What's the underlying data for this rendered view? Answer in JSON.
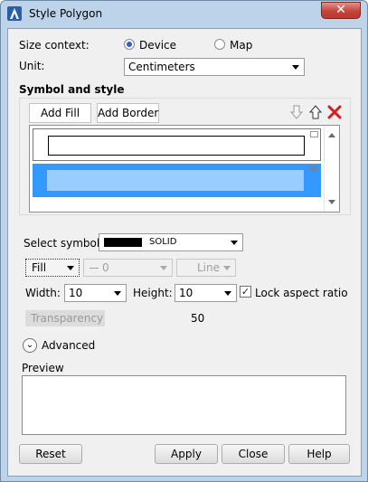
{
  "window": {
    "title": "Style Polygon",
    "close_glyph": "✕"
  },
  "size_context": {
    "label": "Size context:",
    "options": [
      {
        "label": "Device",
        "selected": true
      },
      {
        "label": "Map",
        "selected": false
      }
    ]
  },
  "unit": {
    "label": "Unit:",
    "value": "Centimeters"
  },
  "symbol_and_style": {
    "heading": "Symbol and style",
    "add_fill_label": "Add Fill",
    "add_border_label": "Add Border",
    "icons": [
      "move-down-icon",
      "move-up-icon",
      "delete-icon"
    ]
  },
  "select_symbol": {
    "label": "Select symbol:",
    "value": "SOLID",
    "swatch_color": "#000000"
  },
  "fill_row": {
    "type_value": "Fill",
    "line_value": "0",
    "line_type_value": "Line"
  },
  "dimensions": {
    "width_label": "Width:",
    "width_value": "10",
    "height_label": "Height:",
    "height_value": "10",
    "lock_label": "Lock aspect ratio",
    "lock_checked": true
  },
  "transparency": {
    "label": "Transparency",
    "value": "50"
  },
  "advanced": {
    "label": "Advanced"
  },
  "preview": {
    "label": "Preview"
  },
  "buttons": {
    "reset": "Reset",
    "apply": "Apply",
    "close": "Close",
    "help": "Help"
  },
  "colors": {
    "selection": "#3399ff",
    "selection_inner": "#99ccff",
    "close_red": "#c6453a"
  }
}
